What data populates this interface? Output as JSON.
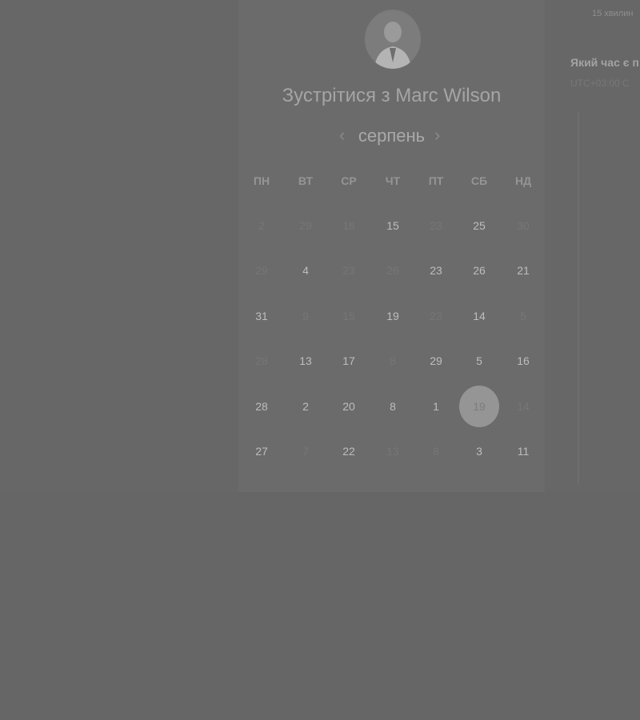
{
  "meeting": {
    "title": "Зустрітися з Marc Wilson",
    "avatar_icon": "person-avatar-icon"
  },
  "calendar": {
    "month": "серпень",
    "prev_icon": "chevron-left-icon",
    "next_icon": "chevron-right-icon",
    "weekdays": [
      "ПН",
      "ВТ",
      "СР",
      "ЧТ",
      "ПТ",
      "СБ",
      "НД"
    ],
    "weeks": [
      [
        {
          "label": "2",
          "active": false
        },
        {
          "label": "29",
          "active": false
        },
        {
          "label": "18",
          "active": false
        },
        {
          "label": "15",
          "active": true
        },
        {
          "label": "23",
          "active": false
        },
        {
          "label": "25",
          "active": true
        },
        {
          "label": "30",
          "active": false
        }
      ],
      [
        {
          "label": "29",
          "active": false
        },
        {
          "label": "4",
          "active": true
        },
        {
          "label": "23",
          "active": false
        },
        {
          "label": "26",
          "active": false
        },
        {
          "label": "23",
          "active": true
        },
        {
          "label": "26",
          "active": true
        },
        {
          "label": "21",
          "active": true
        }
      ],
      [
        {
          "label": "31",
          "active": true
        },
        {
          "label": "9",
          "active": false
        },
        {
          "label": "15",
          "active": false
        },
        {
          "label": "19",
          "active": true
        },
        {
          "label": "23",
          "active": false
        },
        {
          "label": "14",
          "active": true
        },
        {
          "label": "5",
          "active": false
        }
      ],
      [
        {
          "label": "28",
          "active": false
        },
        {
          "label": "13",
          "active": true
        },
        {
          "label": "17",
          "active": true
        },
        {
          "label": "8",
          "active": false
        },
        {
          "label": "29",
          "active": true
        },
        {
          "label": "5",
          "active": true
        },
        {
          "label": "16",
          "active": true
        }
      ],
      [
        {
          "label": "28",
          "active": true
        },
        {
          "label": "2",
          "active": true
        },
        {
          "label": "20",
          "active": true
        },
        {
          "label": "8",
          "active": true
        },
        {
          "label": "1",
          "active": true
        },
        {
          "label": "19",
          "active": true,
          "selected": true
        },
        {
          "label": "14",
          "active": false
        }
      ],
      [
        {
          "label": "27",
          "active": true
        },
        {
          "label": "7",
          "active": false
        },
        {
          "label": "22",
          "active": true
        },
        {
          "label": "13",
          "active": false
        },
        {
          "label": "8",
          "active": false
        },
        {
          "label": "3",
          "active": true
        },
        {
          "label": "11",
          "active": true
        }
      ]
    ]
  },
  "right_panel": {
    "duration": "15 хвилин",
    "time_question": "Який час є п",
    "timezone": "UTC+03:00 C"
  },
  "colors": {
    "overlay": "#666666",
    "selected_day_bg": "#959595"
  }
}
